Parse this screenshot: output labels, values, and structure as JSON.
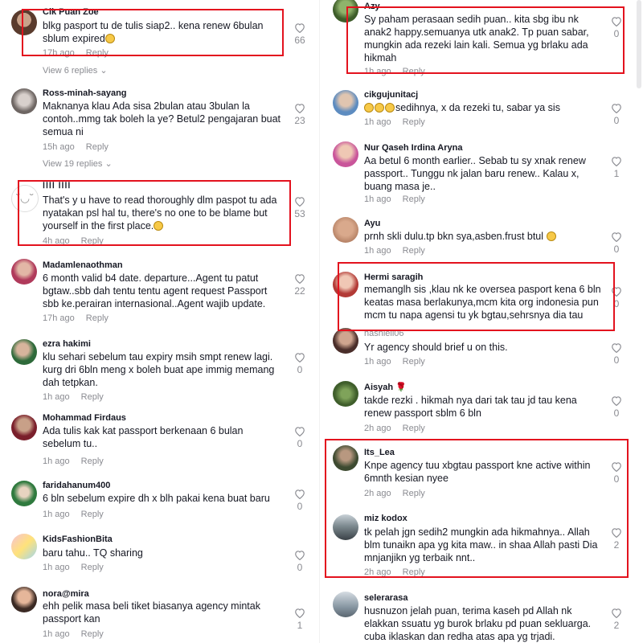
{
  "left": [
    {
      "user": "Cik Puan Zoe",
      "text": "blkg pasport tu de tulis siap2.. kena renew 6bulan sblum expired",
      "emoji": true,
      "time": "17h ago",
      "reply": "Reply",
      "likes": "66",
      "replies": "View 6 replies"
    },
    {
      "user": "Ross-minah-sayang",
      "text": "Maknanya klau Ada sisa 2bulan atau 3bulan la contoh..mmg tak boleh la ye? Betul2 pengajaran buat semua ni",
      "time": "15h ago",
      "reply": "Reply",
      "likes": "23",
      "replies": "View 19 replies"
    },
    {
      "user": "ꓲꓲꓲꓲ ꓲꓲꓲꓲ",
      "text": "That's y u have to read thoroughly dlm paspot tu ada nyatakan psl hal tu, there's no one to be blame but yourself in the first place.",
      "emoji": true,
      "time": "4h ago",
      "reply": "Reply",
      "likes": "53"
    },
    {
      "user": "Madamlenaothman",
      "text": "6 month valid b4 date. departure...Agent tu patut bgtaw..sbb dah tentu tentu agent request Passport sbb ke.perairan internasional..Agent wajib update.",
      "time": "17h ago",
      "reply": "Reply",
      "likes": "22"
    },
    {
      "user": "ezra hakimi",
      "text": "klu sehari sebelum tau expiry msih smpt renew lagi. kurg dri 6bln meng x boleh buat ape immig memang dah tetpkan.",
      "time": "1h ago",
      "reply": "Reply",
      "likes": "0"
    },
    {
      "user": "Mohammad Firdaus",
      "text": "Ada tulis kak kat passport berkenaan 6 bulan sebelum tu..",
      "time": "1h ago",
      "reply": "Reply",
      "likes": "0"
    },
    {
      "user": "faridahanum400",
      "text": "6 bln sebelum expire dh x blh pakai kena buat baru",
      "time": "1h ago",
      "reply": "Reply",
      "likes": "0"
    },
    {
      "user": "KidsFashionBita",
      "text": "baru tahu.. TQ sharing",
      "time": "1h ago",
      "reply": "Reply",
      "likes": "0"
    },
    {
      "user": "nora@mira",
      "text": "ehh pelik masa beli tiket biasanya agency mintak passport kan",
      "time": "1h ago",
      "reply": "Reply",
      "likes": "1"
    }
  ],
  "right": [
    {
      "user": "Azy",
      "text": "Sy paham perasaan sedih puan.. kita sbg ibu nk anak2 happy.semuanya utk anak2. Tp puan sabar, mungkin ada rezeki lain kali. Semua yg brlaku ada hikmah",
      "time": "1h ago",
      "reply": "Reply",
      "likes": "0"
    },
    {
      "user": "cikgujunitacj",
      "text": "sedihnya, x da rezeki tu, sabar ya sis",
      "emoji3": true,
      "time": "1h ago",
      "reply": "Reply",
      "likes": "0"
    },
    {
      "user": "Nur Qaseh Irdina Aryna",
      "text": "Aa betul 6 month earlier.. Sebab tu sy xnak renew passport.. Tunggu nk jalan baru renew.. Kalau x, buang masa je..",
      "time": "1h ago",
      "reply": "Reply",
      "likes": "1"
    },
    {
      "user": "Ayu",
      "text": "prnh skli dulu.tp bkn sya,asben.frust btul",
      "emoji": true,
      "time": "1h ago",
      "reply": "Reply",
      "likes": "0"
    },
    {
      "user": "Hermi saragih",
      "text": "memanglh sis ,klau nk ke oversea pasport kena 6 bln keatas masa berlakunya,mcm kita org indonesia pun mcm tu napa agensi tu yk bgtau,sehrsnya dia tau",
      "time": "",
      "reply": "",
      "likes": "0"
    },
    {
      "user": "hasnieli06",
      "text": "Yr agency should brief u on this.",
      "time": "1h ago",
      "reply": "Reply",
      "likes": "0"
    },
    {
      "user": "Aisyah 🌹",
      "text": "takde rezki . hikmah nya dari tak tau jd tau kena renew passport sblm 6 bln",
      "time": "2h ago",
      "reply": "Reply",
      "likes": "0"
    },
    {
      "user": "Its_Lea",
      "text": "Knpe agency tuu xbgtau passport kne active within 6mnth kesian nyee",
      "time": "2h ago",
      "reply": "Reply",
      "likes": "0"
    },
    {
      "user": "miz kodox",
      "text": "tk pelah jgn sedih2 mungkin ada hikmahnya.. Allah blm tunaikn apa yg kita maw.. in shaa Allah pasti Dia mnjanjikn yg terbaik nnt..",
      "time": "2h ago",
      "reply": "Reply",
      "likes": "2"
    },
    {
      "user": "selerarasa",
      "text": "husnuzon jelah puan, terima kaseh pd Allah nk elakkan ssuatu yg burok brlaku pd puan sekluarga. cuba iklaskan dan redha atas apa yg trjadi.",
      "time": "",
      "reply": "",
      "likes": "2"
    }
  ],
  "colors": {
    "highlight": "#e3121e",
    "muted": "#8a8b91",
    "text": "#161823"
  }
}
